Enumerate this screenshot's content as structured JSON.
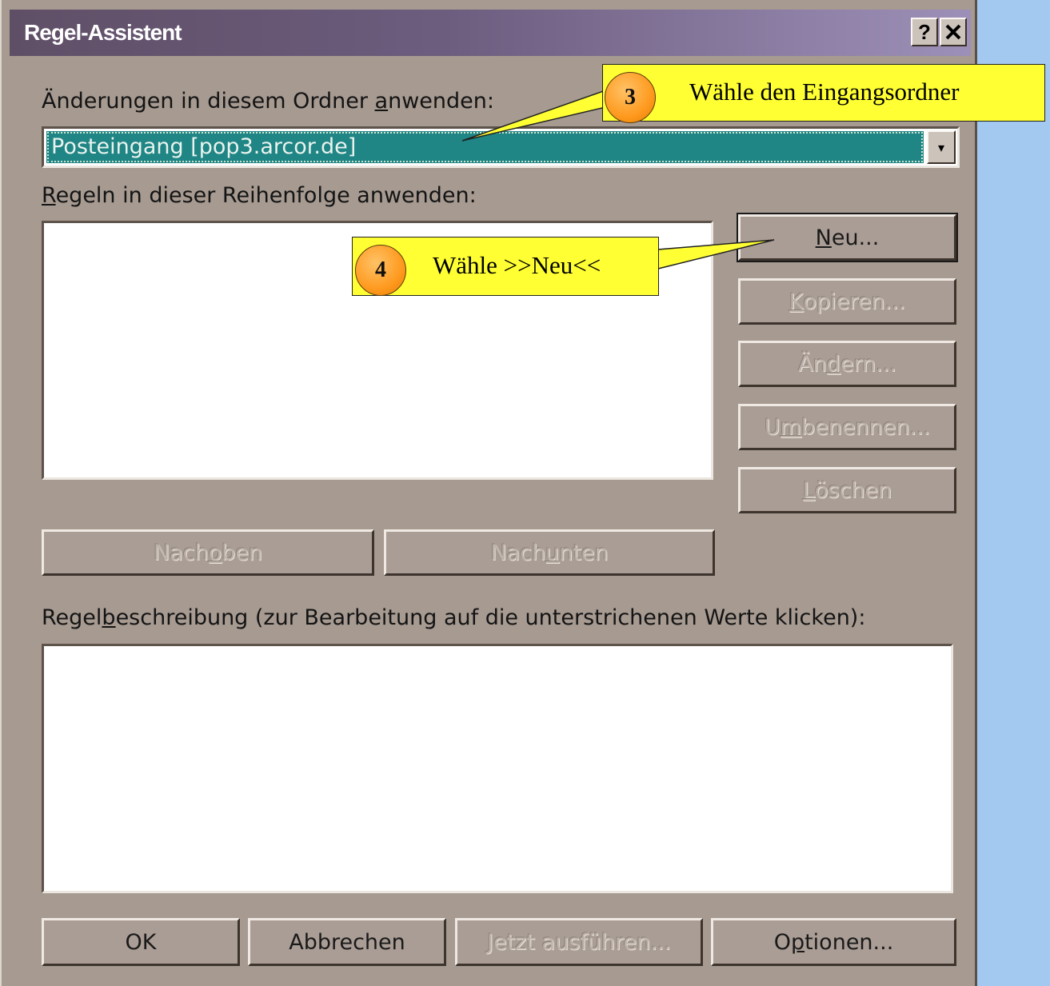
{
  "window": {
    "title": "Regel-Assistent",
    "help_label": "?",
    "close_label": "✕"
  },
  "folder": {
    "label_pre": "Änderungen in diesem Ordner ",
    "label_hot": "a",
    "label_post": "nwenden:",
    "selected_value": "Posteingang [pop3.arcor.de]",
    "dropdown_icon": "▾"
  },
  "rules": {
    "label_hot": "R",
    "label_post": "egeln in dieser Reihenfolge anwenden:",
    "items": []
  },
  "side_buttons": {
    "neu": {
      "hot": "N",
      "rest": "eu..."
    },
    "kopieren": {
      "hot": "K",
      "rest": "opieren..."
    },
    "aendern": {
      "pre": "Än",
      "hot": "d",
      "rest": "ern..."
    },
    "umbenennen": {
      "pre": "U",
      "hot": "m",
      "rest": "benennen..."
    },
    "loeschen": {
      "hot": "L",
      "rest": "öschen"
    }
  },
  "move_buttons": {
    "up": {
      "pre": "Nach ",
      "hot": "o",
      "rest": "ben"
    },
    "down": {
      "pre": "Nach ",
      "hot": "u",
      "rest": "nten"
    }
  },
  "description": {
    "label_pre": "Regel",
    "label_hot": "b",
    "label_post": "eschreibung (zur Bearbeitung auf die unterstrichenen Werte klicken):",
    "content": ""
  },
  "bottom_buttons": {
    "ok": "OK",
    "cancel": "Abbrechen",
    "run": {
      "hot": "J",
      "rest": "etzt ausführen..."
    },
    "options": {
      "pre": "O",
      "hot": "p",
      "rest": "tionen..."
    }
  },
  "callouts": [
    {
      "number": "3",
      "text": "Wähle den Eingangsordner"
    },
    {
      "number": "4",
      "text": "Wähle >>Neu<<"
    }
  ],
  "colors": {
    "dialog_bg": "#a69a91",
    "selection": "#1f8585",
    "callout_yellow": "#ffff33",
    "badge_orange": "#ff9a1f",
    "page_bg": "#a3c9f0"
  }
}
